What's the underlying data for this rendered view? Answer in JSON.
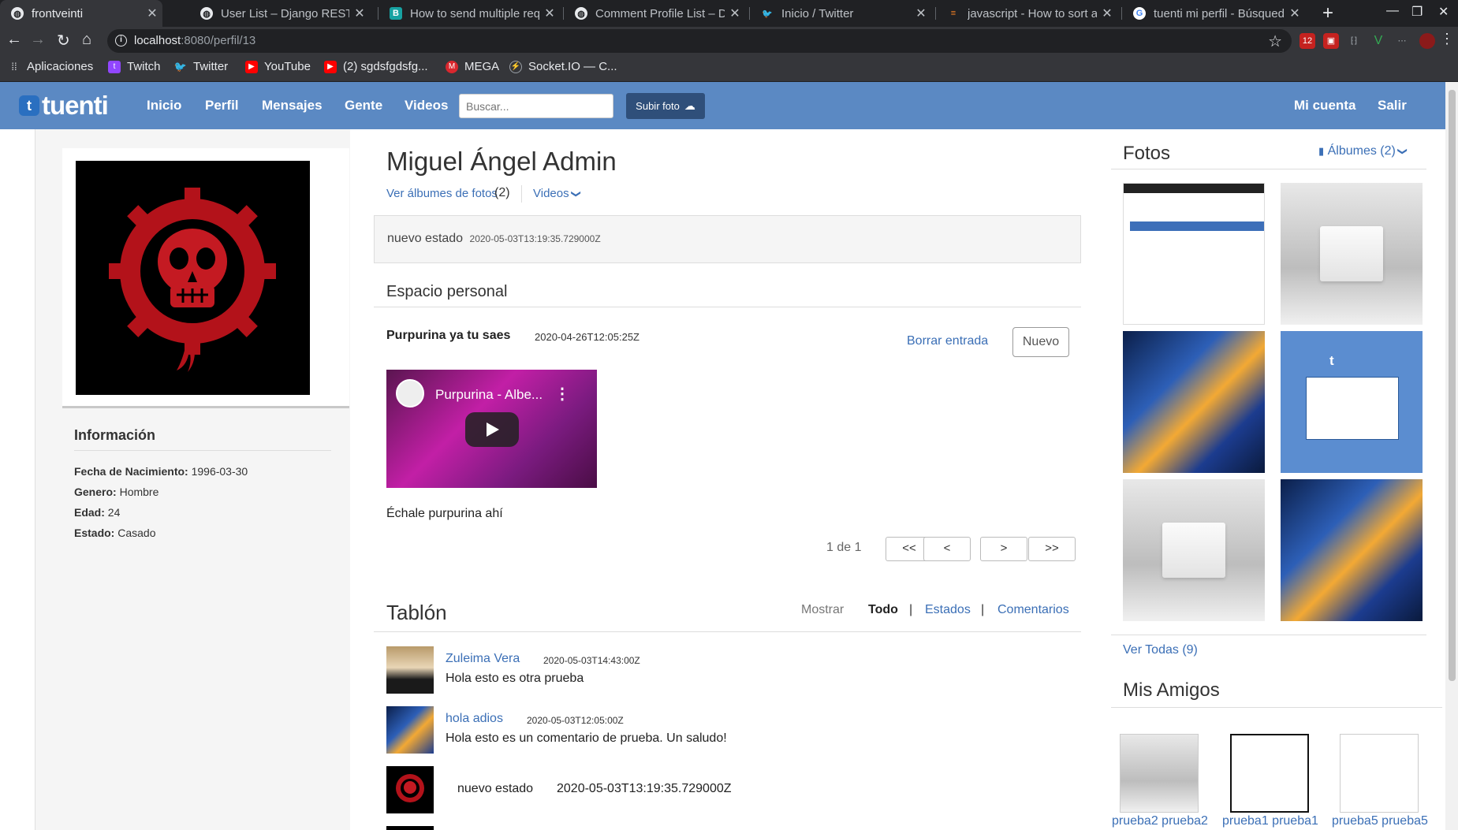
{
  "browser": {
    "tabs": [
      {
        "title": "frontveinti",
        "active": true,
        "icon": "globe-icon"
      },
      {
        "title": "User List – Django REST fr",
        "active": false,
        "icon": "globe-icon"
      },
      {
        "title": "How to send multiple req",
        "active": false,
        "icon": "document-icon"
      },
      {
        "title": "Comment Profile List – Dj",
        "active": false,
        "icon": "globe-icon"
      },
      {
        "title": "Inicio / Twitter",
        "active": false,
        "icon": "twitter-icon"
      },
      {
        "title": "javascript - How to sort an",
        "active": false,
        "icon": "stackoverflow-icon"
      },
      {
        "title": "tuenti mi perfil - Búsqued",
        "active": false,
        "icon": "google-icon"
      }
    ],
    "url_host": "localhost",
    "url_rest": ":8080/perfil/13",
    "extension_badge": "12",
    "bookmarks": [
      {
        "label": "Aplicaciones",
        "icon": "apps-grid-icon"
      },
      {
        "label": "Twitch",
        "icon": "twitch-icon"
      },
      {
        "label": "Twitter",
        "icon": "twitter-icon"
      },
      {
        "label": "YouTube",
        "icon": "youtube-icon"
      },
      {
        "label": "(2) sgdsfgdsfg...",
        "icon": "youtube-icon"
      },
      {
        "label": "MEGA",
        "icon": "mega-icon"
      },
      {
        "label": "Socket.IO — C...",
        "icon": "socketio-icon"
      }
    ]
  },
  "header": {
    "logo": "tuenti",
    "nav": [
      "Inicio",
      "Perfil",
      "Mensajes",
      "Gente",
      "Videos"
    ],
    "search_placeholder": "Buscar...",
    "upload_label": "Subir foto",
    "account_label": "Mi cuenta",
    "logout_label": "Salir",
    "brand_color": "#5b89c3"
  },
  "info": {
    "title": "Información",
    "rows": [
      {
        "label": "Fecha de Nacimiento:",
        "value": "1996-03-30"
      },
      {
        "label": "Genero:",
        "value": "Hombre"
      },
      {
        "label": "Edad:",
        "value": "24"
      },
      {
        "label": "Estado:",
        "value": "Casado"
      }
    ]
  },
  "profile": {
    "name": "Miguel Ángel Admin",
    "albums_link": "Ver álbumes de fotos",
    "albums_count": "(2)",
    "videos_label": "Videos",
    "status_text": "nuevo estado",
    "status_date": "2020-05-03T13:19:35.729000Z"
  },
  "espacio": {
    "title": "Espacio personal",
    "entry_title": "Purpurina ya tu saes",
    "entry_date": "2020-04-26T12:05:25Z",
    "delete_label": "Borrar entrada",
    "new_label": "Nuevo",
    "video_title": "Purpurina - Albe...",
    "entry_body": "Échale purpurina ahí",
    "pagination": {
      "info": "1 de 1",
      "first": "<<",
      "prev": "<",
      "next": ">",
      "last": ">>"
    }
  },
  "tablon": {
    "title": "Tablón",
    "show_label": "Mostrar",
    "filters": [
      "Todo",
      "Estados",
      "Comentarios"
    ],
    "separator": "|",
    "posts": [
      {
        "author": "Zuleima Vera",
        "date": "2020-05-03T14:43:00Z",
        "text": "Hola esto es otra prueba"
      },
      {
        "author": "hola adios",
        "date": "2020-05-03T12:05:00Z",
        "text": "Hola esto es un comentario de prueba. Un saludo!"
      },
      {
        "author": "",
        "date": "2020-05-03T13:19:35.729000Z",
        "text": "nuevo estado"
      }
    ]
  },
  "fotos": {
    "title": "Fotos",
    "albums_label": "Álbumes (2)",
    "see_all": "Ver Todas (9)"
  },
  "amigos": {
    "title": "Mis Amigos",
    "friends": [
      "prueba2 prueba2",
      "prueba1 prueba1",
      "prueba5 prueba5"
    ]
  }
}
